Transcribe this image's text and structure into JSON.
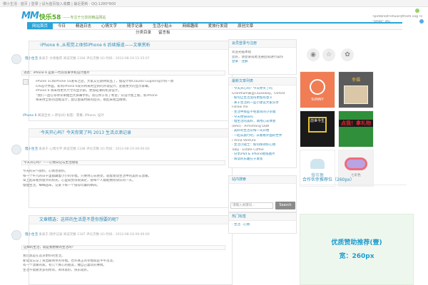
{
  "topbar": {
    "text": "慢小生活  ·  首页  |  登录  |  设为首页加入收藏  |  最近更新  ·  QQ:1280*800"
  },
  "logo": {
    "mark": "MM",
    "name": "快乐58",
    "slogan": "——专注于分享的精品网站"
  },
  "side_links": [
    "•pinterest•shuio•jtfcom  vxg  •ovdr",
    "\"smile\"  vtu"
  ],
  "nav": {
    "items": [
      "网站首页",
      "今日",
      "精选日志",
      "心情文字",
      "随手记录",
      "生活小贴士",
      "网络趣闻",
      "爱旅行发现",
      "原创文章"
    ],
    "sub": [
      "分类目录",
      "留言板"
    ]
  },
  "posts": [
    {
      "title": "·iPhone 6 ,从视觉上体验iPhone 6 后续报道——文章赏析",
      "meta_by": "慢小生活",
      "meta_rest": " 发表于 文章推荐 阅读次数 1184 评论次数 (0)  时间：2013-08-19  15:35:07",
      "quote": "消息：iPhone 6 是新一代的苹果手机设计图片",
      "lines": [
        "iPhone 5C和iPhone 5S发布之后，大家又在期待新品了，据设计师Claudio Guglieri设计的一款",
        "iOS设计界面。新的iPhone 6或许将采用全新的外观设计，配备更大的显示屏幕。",
        "iPhone 6 将采用更大尺寸的显示屏，更加轻薄的机身设计。",
        "“我们一直在等待苹果推出大屏幕手机，现在终于有了希望。”从设计图上看，新iPhone",
        "将采用全新的边框设计，配以金属材质的后壳，看起来相当精致。"
      ],
      "more_link": "iPhone 6",
      "more_rest": "  阅读全文 »  评论(0)  标签：苹果, iPhone, 设计"
    },
    {
      "title": "·今天开心吗？今天你笑了吗 2013 生活点滴记录",
      "meta_by": "慢小生活",
      "meta_rest": " 发表于 心情文字 阅读次数 1188 评论次数 (0)  时间：2013-08-19  09:00:00",
      "quote": "今天开心吗？——心情日记与生活随笔",
      "lines": [
        "今天的天气很好，心情也很好。",
        "每一个平凡的日子里都藏着小小的幸福，只要用心去感受，就能发现生活中的美好与温暖。",
        "早上起床看到窗外的阳光，心里就觉得很满足，愿每个人都能拥有快乐的一天。",
        "慢慢生活，细细品味，记录下每一个值得珍藏的瞬间。"
      ]
    },
    {
      "title": "文章精选：这样的生活是不是你想要的呢？",
      "meta_by": "慢小生活",
      "meta_rest": " 发表于 随手记录 阅读次数 1187 评论次数 (0)  时间：2013-08-18  09:00:00",
      "quote": "这样的生活，就是我想要的生活吗？",
      "lines": [
        "我们总是在追求更好的生活，",
        "却常常忘记了身边最简单的幸福。也许真正的幸福就是平平淡淡，",
        "有一个温暖的家，有几个真心的朋友，做自己喜欢的事情。",
        "生活不需要太多的修饰，简单就好，快乐就好。"
      ]
    }
  ],
  "sidebar": {
    "login_title": "会员登录与注册",
    "login_lines": [
      "欢迎光临本站",
      "您好，请登录或者注册后再进行操作",
      "登录 · 注册"
    ],
    "news_title": "最新文章列表",
    "news_lines": [
      "· 今天开心吗？今天你笑了吗",
      "  Grantham来自Causeway，Oxford",
      "· 如何让生活变得更加有意义",
      "· 关于生活的一些小建议大家分享",
      "  Follow me",
      "· 生活中那些不经意间的小幸福",
      "· 今天你快乐吗",
      "· 慢生活的美好，请用心去体会",
      "  (BAU) · Armstrong DLW",
      "· 美好的生活从每一天开始",
      "· 一起去旅行吧，去看看外面的世界",
      "  / Anna Ventura",
      "· 生活小贴士：如何保持好心情",
      "  Toby · Estate Coffee",
      "· 分享iPad & iPhone壁纸图片",
      "· 阅读的乐趣在于发现"
    ],
    "search_title": "站内搜索",
    "search_placeholder": "请输入关键词...",
    "search_button": "Search",
    "tags_title": "热门标签",
    "tags_lines": [
      "· 生活  · 心情"
    ]
  },
  "tiles": [
    {
      "label": "SUNNY",
      "bg": "#f07d54"
    },
    {
      "label": "幸福",
      "bg": "#5b5b5b"
    },
    {
      "label": "前世今生",
      "bg": "#1a1a1a"
    },
    {
      "label": "点我！拿礼物",
      "bg": "#2f8f3a"
    },
    {
      "label": "慢市集",
      "bg": "#ffffff"
    },
    {
      "label": "七彩色",
      "bg": "#f2f2f2"
    }
  ],
  "ad": {
    "title": "合作伙伴推荐位（260px）",
    "line1": "优质赞助推荐(壹)",
    "line2": "宽：260px"
  },
  "colors": {
    "accent": "#2aa4d8",
    "link": "#2e8cb8",
    "search_button": "#8b8b8b"
  }
}
